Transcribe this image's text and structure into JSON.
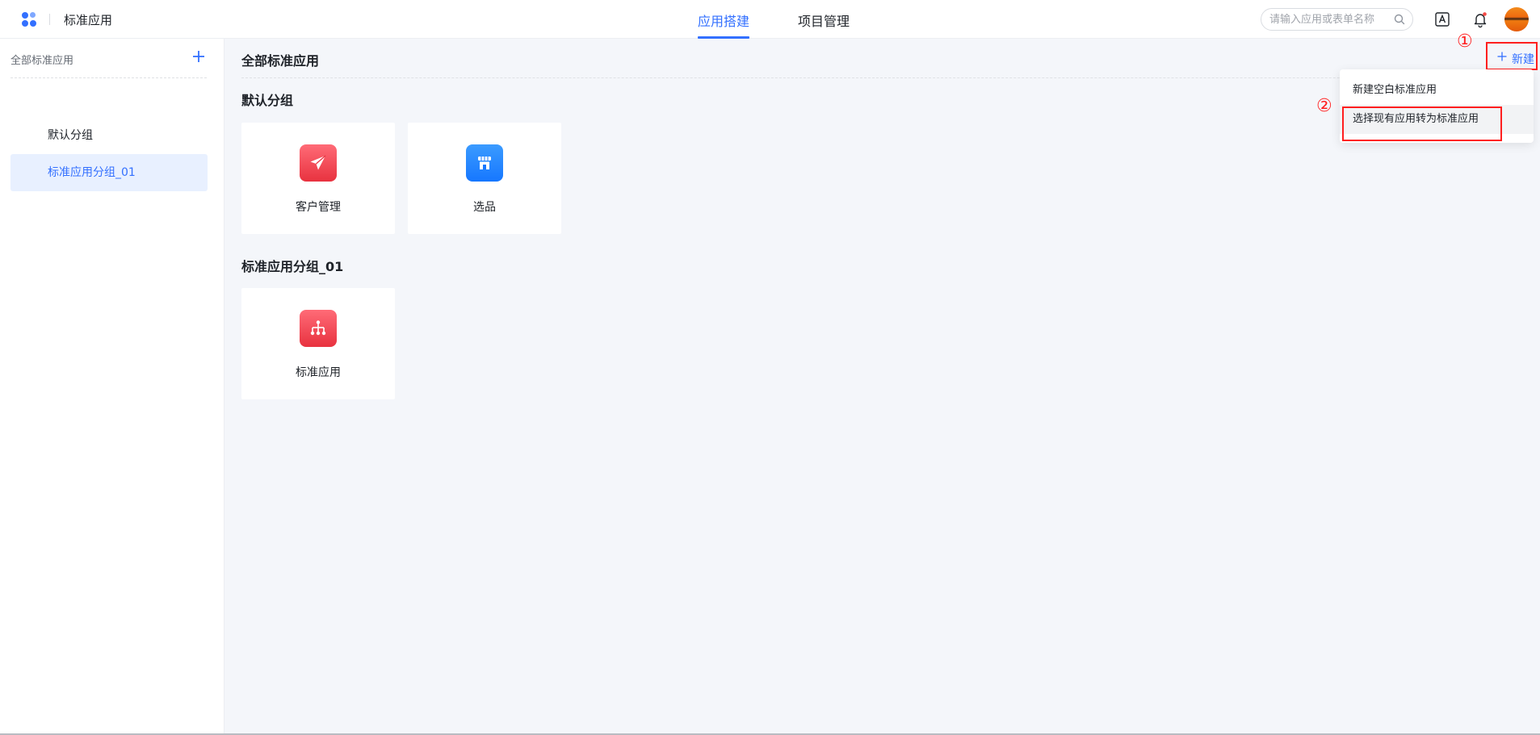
{
  "header": {
    "app_title": "标准应用",
    "tabs": [
      {
        "label": "应用搭建",
        "active": true
      },
      {
        "label": "项目管理",
        "active": false
      }
    ],
    "search_placeholder": "请输入应用或表单名称"
  },
  "sidebar": {
    "title": "全部标准应用",
    "items": [
      {
        "label": "默认分组",
        "active": false
      },
      {
        "label": "标准应用分组_01",
        "active": true
      }
    ]
  },
  "main": {
    "title": "全部标准应用",
    "new_button_label": "新建",
    "groups": [
      {
        "title": "默认分组",
        "apps": [
          {
            "label": "客户管理",
            "icon": "paper-plane-icon",
            "color": "#e8323f"
          },
          {
            "label": "选品",
            "icon": "store-icon",
            "color": "#1677ff"
          }
        ]
      },
      {
        "title": "标准应用分组_01",
        "apps": [
          {
            "label": "标准应用",
            "icon": "org-chart-icon",
            "color": "#e8323f"
          }
        ]
      }
    ]
  },
  "dropdown": {
    "items": [
      {
        "label": "新建空白标准应用"
      },
      {
        "label": "选择现有应用转为标准应用"
      }
    ]
  },
  "annotations": {
    "marker_1": "①",
    "marker_2": "②"
  },
  "colors": {
    "accent": "#3370ff",
    "annotation": "#ff1f1f"
  }
}
